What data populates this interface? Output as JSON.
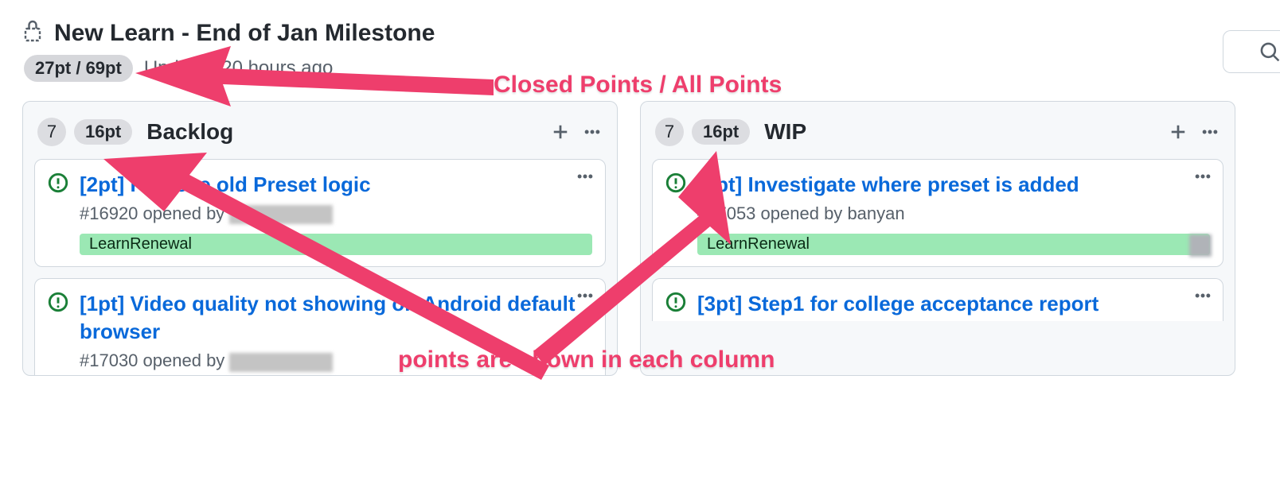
{
  "header": {
    "title": "New Learn - End of Jan Milestone",
    "points_summary": "27pt / 69pt",
    "updated_text": "Updated 20 hours ago"
  },
  "search": {
    "placeholder": ""
  },
  "annotations": {
    "top": "Closed Points / All Points",
    "mid": "points are shown in each column"
  },
  "columns": [
    {
      "count": "7",
      "points": "16pt",
      "title": "Backlog",
      "cards": [
        {
          "title": "[2pt] Remove old Preset logic",
          "issue": "#16920",
          "opened_by_prefix": "opened by",
          "author_redacted": true,
          "label": "LearnRenewal"
        },
        {
          "title": "[1pt] Video quality not showing on Android default browser",
          "issue": "#17030",
          "opened_by_prefix": "opened by",
          "author_redacted": true
        }
      ]
    },
    {
      "count": "7",
      "points": "16pt",
      "title": "WIP",
      "cards": [
        {
          "title": "[1pt] Investigate where preset is added",
          "issue": "#17053",
          "opened_by_prefix": "opened by",
          "author": "banyan",
          "label": "LearnRenewal",
          "has_avatar": true
        },
        {
          "title": "[3pt] Step1 for college acceptance report",
          "issue": "",
          "opened_by_prefix": "",
          "partial": true
        }
      ]
    }
  ]
}
